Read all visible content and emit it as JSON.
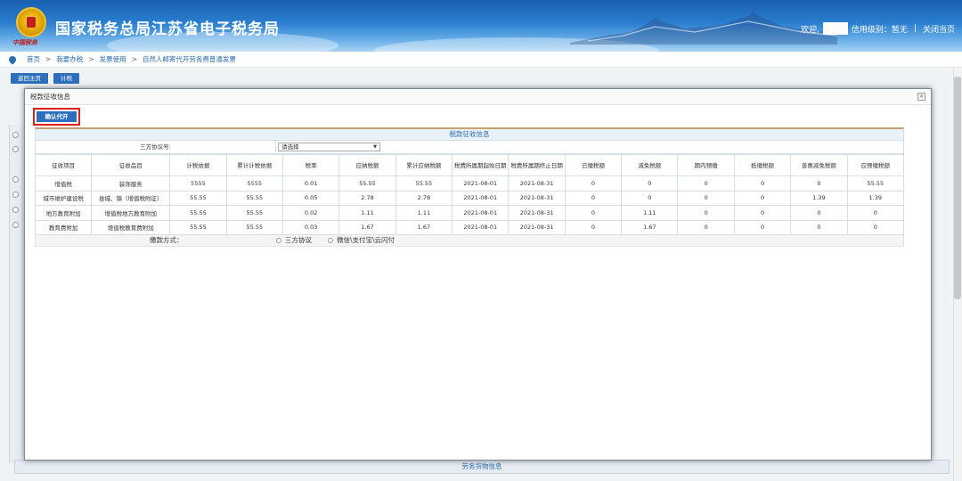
{
  "header": {
    "title": "国家税务总局江苏省电子税务局",
    "emblem_text": "中国税务",
    "welcome": "欢迎,",
    "credit_level": "信用级别：暂无",
    "separator": "|",
    "close_page": "关闭当页"
  },
  "breadcrumb": {
    "items": [
      "首页",
      "我要办税",
      "发票使用",
      "自然人邮寄代开劳务费普通发票"
    ],
    "arrow": ">"
  },
  "background": {
    "buttons": [
      "返回主页",
      "计税"
    ],
    "bottom_section": "劳务货物信息"
  },
  "modal": {
    "title": "税款征收信息",
    "close": "×",
    "confirm_button": "确认代开",
    "panel_title": "税款征收信息",
    "agreement_label": "三方协议号:",
    "agreement_select": "请选择",
    "table": {
      "headers": [
        "征收项目",
        "征收品目",
        "计税依据",
        "累计计税依据",
        "税率",
        "应纳税额",
        "累计应纳税额",
        "税费所属期起始日期",
        "税费所属期终止日期",
        "已缴税额",
        "减免税额",
        "期内预缴",
        "抵缴税额",
        "普惠减免税额",
        "应预缴税额"
      ],
      "rows": [
        [
          "增值税",
          "装饰服务",
          "5555",
          "5555",
          "0.01",
          "55.55",
          "55.55",
          "2021-08-01",
          "2021-08-31",
          "0",
          "0",
          "0",
          "0",
          "0",
          "55.55"
        ],
        [
          "城市维护建设税",
          "县城、镇（增值税附征）",
          "55.55",
          "55.55",
          "0.05",
          "2.78",
          "2.78",
          "2021-08-01",
          "2021-08-31",
          "0",
          "0",
          "0",
          "0",
          "1.39",
          "1.39"
        ],
        [
          "地方教育附加",
          "增值税地方教育附加",
          "55.55",
          "55.55",
          "0.02",
          "1.11",
          "1.11",
          "2021-08-01",
          "2021-08-31",
          "0",
          "1.11",
          "0",
          "0",
          "0",
          "0"
        ],
        [
          "教育费附加",
          "增值税教育费附加",
          "55.55",
          "55.55",
          "0.03",
          "1.67",
          "1.67",
          "2021-08-01",
          "2021-08-31",
          "0",
          "1.67",
          "0",
          "0",
          "0",
          "0"
        ]
      ]
    },
    "payment": {
      "label": "缴款方式：",
      "options": [
        "三方协议",
        "微信\\支付宝\\云闪付"
      ]
    }
  }
}
